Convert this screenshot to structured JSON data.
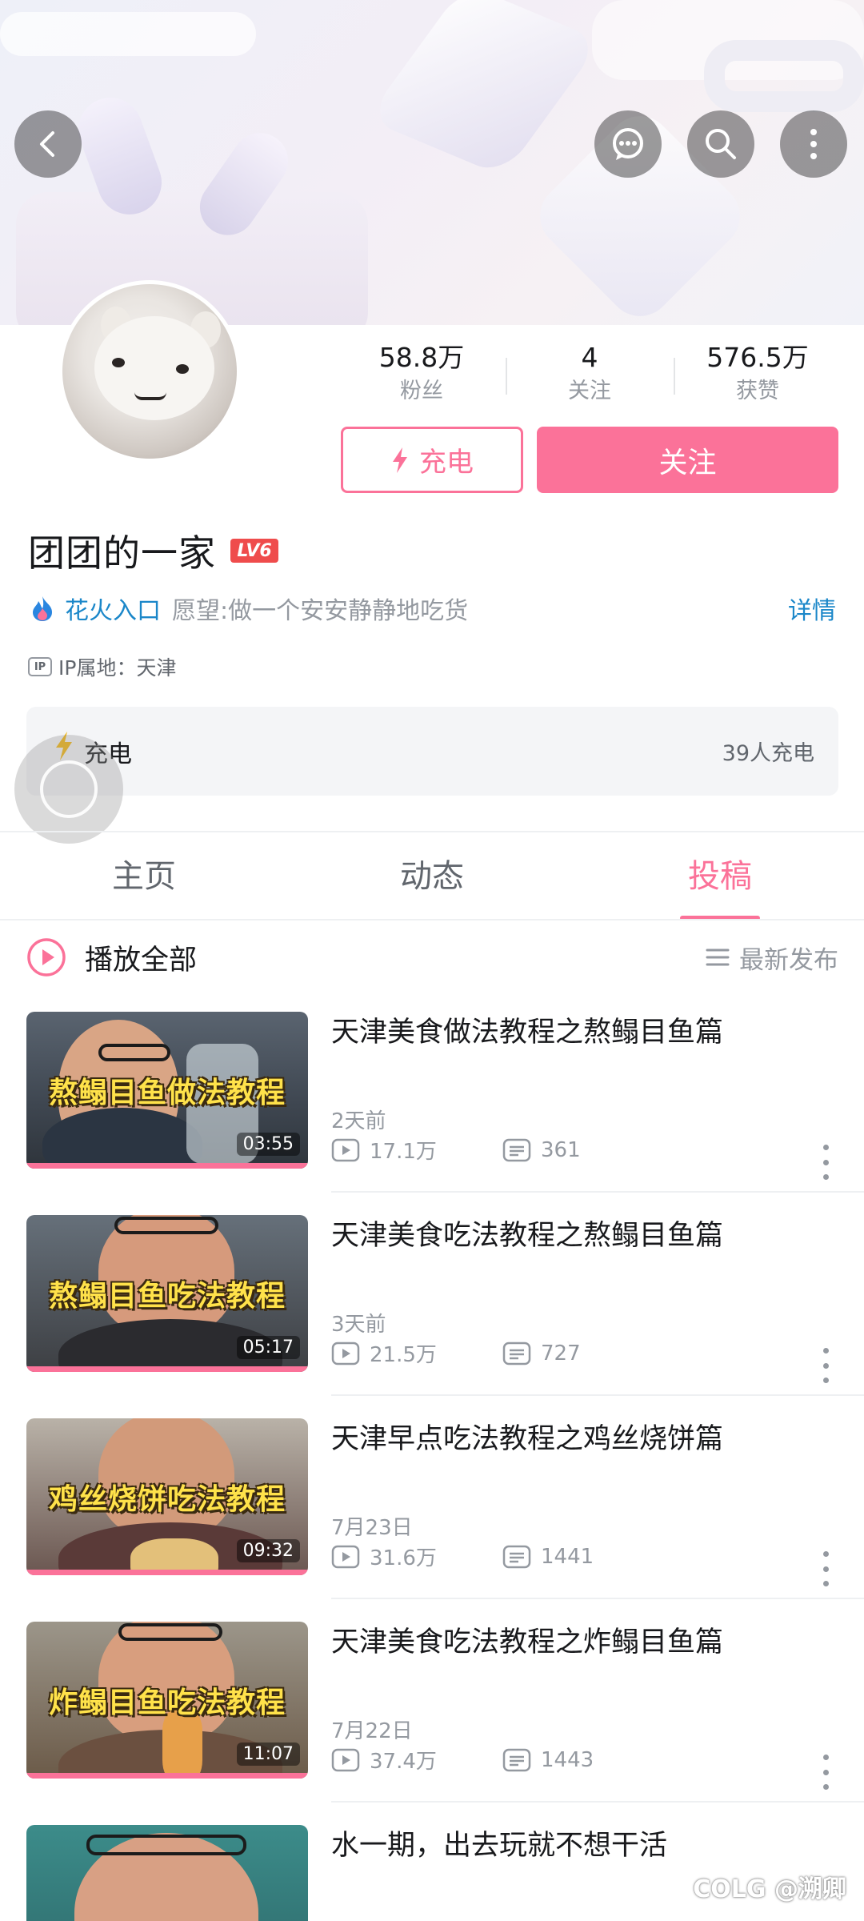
{
  "profile": {
    "name": "团团的一家",
    "level": "LV6",
    "spark_label": "花火入口",
    "signature": "愿望:做一个安安静静地吃货",
    "detail_label": "详情",
    "ip_badge": "IP",
    "ip_location": "IP属地：天津"
  },
  "stats": [
    {
      "value": "58.8万",
      "label": "粉丝"
    },
    {
      "value": "4",
      "label": "关注"
    },
    {
      "value": "576.5万",
      "label": "获赞"
    }
  ],
  "actions": {
    "charge_label": "充电",
    "follow_label": "关注"
  },
  "charge_panel": {
    "title": "充电",
    "count": "39人充电"
  },
  "tabs": [
    {
      "label": "主页",
      "active": false
    },
    {
      "label": "动态",
      "active": false
    },
    {
      "label": "投稿",
      "active": true
    }
  ],
  "list_header": {
    "play_all": "播放全部",
    "sort_label": "最新发布"
  },
  "videos": [
    {
      "title": "天津美食做法教程之熬鳎目鱼篇",
      "caption": "熬鳎目鱼做法教程",
      "duration": "03:55",
      "date": "2天前",
      "plays": "17.1万",
      "comments": "361"
    },
    {
      "title": "天津美食吃法教程之熬鳎目鱼篇",
      "caption": "熬鳎目鱼吃法教程",
      "duration": "05:17",
      "date": "3天前",
      "plays": "21.5万",
      "comments": "727"
    },
    {
      "title": "天津早点吃法教程之鸡丝烧饼篇",
      "caption": "鸡丝烧饼吃法教程",
      "duration": "09:32",
      "date": "7月23日",
      "plays": "31.6万",
      "comments": "1441"
    },
    {
      "title": "天津美食吃法教程之炸鳎目鱼篇",
      "caption": "炸鳎目鱼吃法教程",
      "duration": "11:07",
      "date": "7月22日",
      "plays": "37.4万",
      "comments": "1443"
    },
    {
      "title": "水一期，出去玩就不想干活"
    }
  ],
  "watermark": "COLG @溯卿",
  "colors": {
    "accent_pink": "#fb7299",
    "link_blue": "#1b87c9",
    "muted_gray": "#9499a0",
    "level_red": "#ef4c4c",
    "caption_yellow": "#ffe24a"
  },
  "icons": [
    "back-icon",
    "message-icon",
    "search-icon",
    "more-icon",
    "lightning-icon",
    "spark-icon",
    "ip-icon",
    "play-circle-icon",
    "sort-icon",
    "play-count-icon",
    "comment-icon",
    "kebab-icon"
  ]
}
